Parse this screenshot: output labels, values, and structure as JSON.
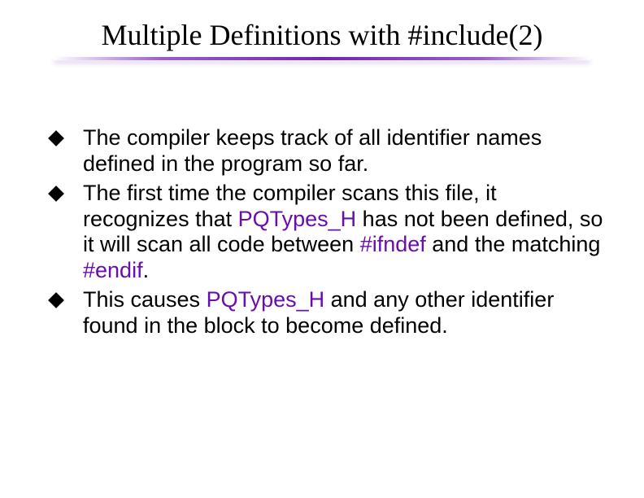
{
  "title": "Multiple Definitions with #include(2)",
  "bullets": [
    {
      "text": "The compiler keeps track of all identifier names defined in the program so far."
    },
    {
      "pre": "The first time the compiler scans this file, it recognizes that ",
      "hl1": "PQTypes_H",
      "mid1": " has not been defined, so it will scan all code between ",
      "hl2": "#ifndef",
      "mid2": " and the matching ",
      "hl3": "#endif",
      "post": "."
    },
    {
      "pre": "This causes ",
      "hl1": "PQTypes_H",
      "post": " and any other identifier found in the block to become defined."
    }
  ]
}
